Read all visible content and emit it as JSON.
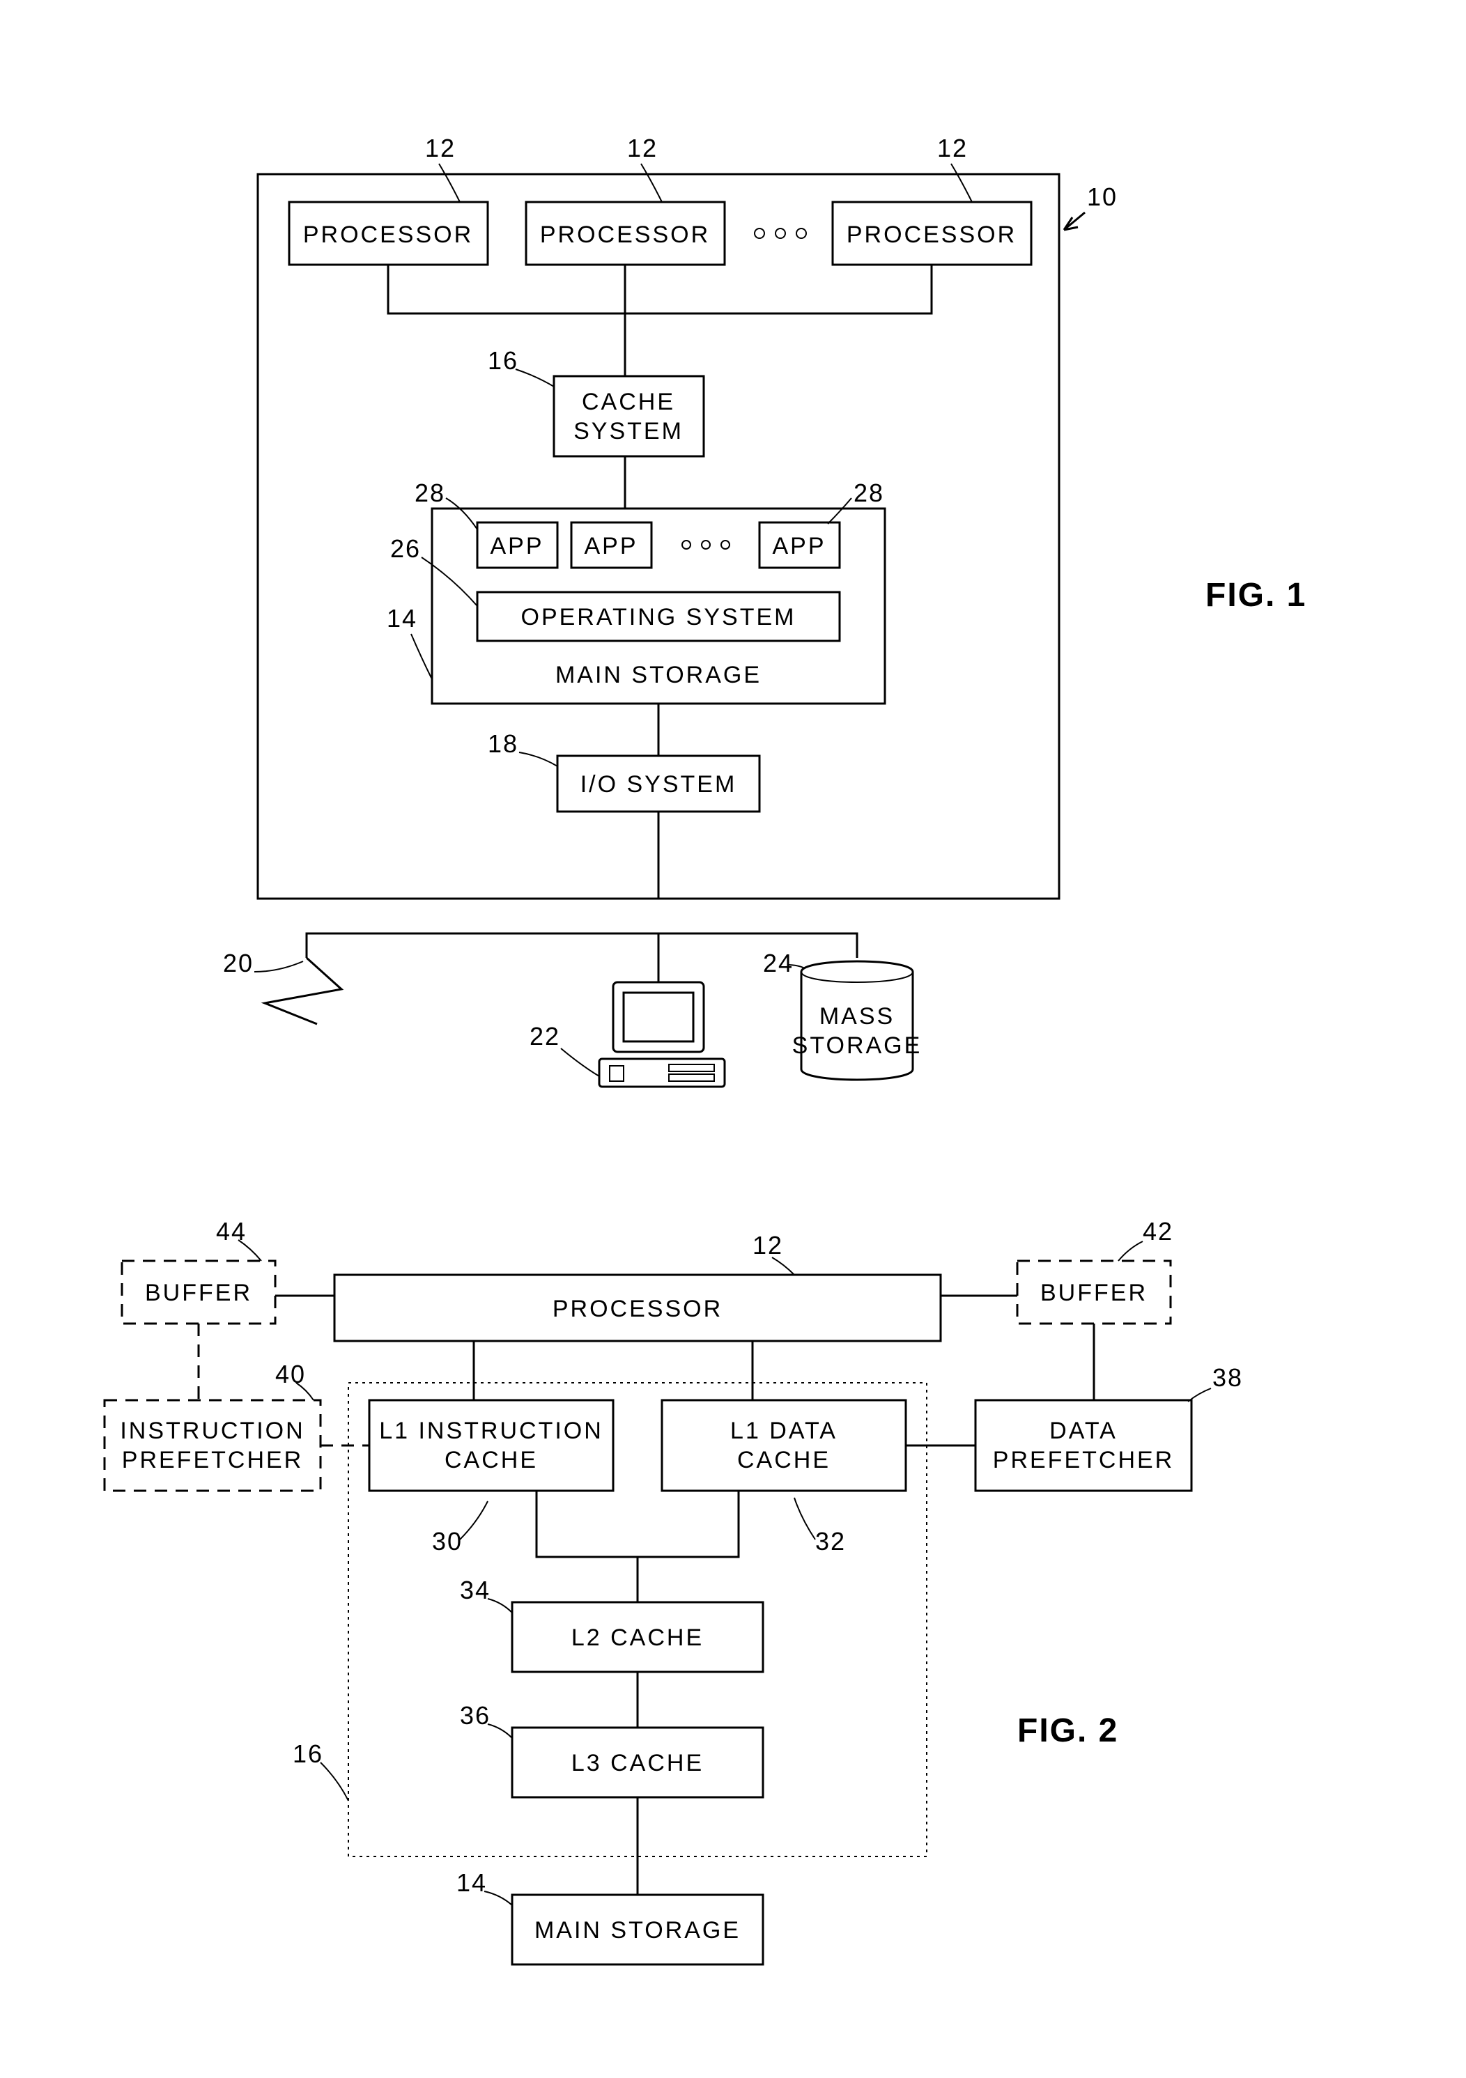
{
  "fig1": {
    "title": "FIG. 1",
    "processor": "PROCESSOR",
    "cache_system_l1": "CACHE",
    "cache_system_l2": "SYSTEM",
    "app": "APP",
    "os": "OPERATING SYSTEM",
    "main_storage": "MAIN STORAGE",
    "io": "I/O SYSTEM",
    "mass_l1": "MASS",
    "mass_l2": "STORAGE",
    "n10": "10",
    "n12": "12",
    "n14": "14",
    "n16": "16",
    "n18": "18",
    "n20": "20",
    "n22": "22",
    "n24": "24",
    "n26": "26",
    "n28": "28"
  },
  "fig2": {
    "title": "FIG. 2",
    "buffer": "BUFFER",
    "processor": "PROCESSOR",
    "instr_pref_l1": "INSTRUCTION",
    "instr_pref_l2": "PREFETCHER",
    "l1i_l1": "L1 INSTRUCTION",
    "l1i_l2": "CACHE",
    "l1d_l1": "L1 DATA",
    "l1d_l2": "CACHE",
    "data_pref_l1": "DATA",
    "data_pref_l2": "PREFETCHER",
    "l2": "L2 CACHE",
    "l3": "L3 CACHE",
    "main_storage": "MAIN STORAGE",
    "n12": "12",
    "n14": "14",
    "n16": "16",
    "n30": "30",
    "n32": "32",
    "n34": "34",
    "n36": "36",
    "n38": "38",
    "n40": "40",
    "n42": "42",
    "n44": "44"
  }
}
